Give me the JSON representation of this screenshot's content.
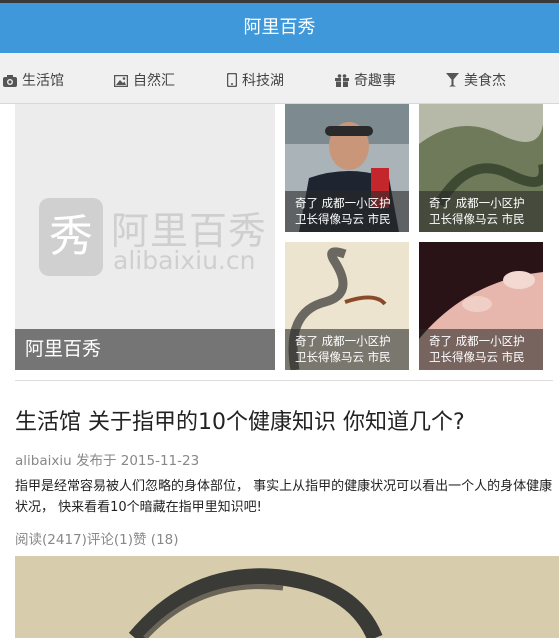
{
  "header": {
    "title": "阿里百秀"
  },
  "nav": {
    "items": [
      {
        "label": "生活馆",
        "icon": "camera-icon"
      },
      {
        "label": "自然汇",
        "icon": "picture-icon"
      },
      {
        "label": "科技湖",
        "icon": "phone-icon"
      },
      {
        "label": "奇趣事",
        "icon": "gift-icon"
      },
      {
        "label": "美食杰",
        "icon": "cocktail-icon"
      }
    ]
  },
  "hero": {
    "logo_char": "秀",
    "logo_title": "阿里百秀",
    "logo_sub": "alibaixiu.cn",
    "caption": "阿里百秀"
  },
  "thumbs": [
    {
      "line1": "奇了 成都一小区护",
      "line2": "卫长得像马云 市民"
    },
    {
      "line1": "奇了 成都一小区护",
      "line2": "卫长得像马云 市民"
    },
    {
      "line1": "奇了 成都一小区护",
      "line2": "卫长得像马云 市民"
    },
    {
      "line1": "奇了 成都一小区护",
      "line2": "卫长得像马云 市民"
    }
  ],
  "article": {
    "title": "生活馆 关于指甲的10个健康知识 你知道几个?",
    "meta": "alibaixiu 发布于 2015-11-23",
    "summary": "指甲是经常容易被人们忽略的身体部位， 事实上从指甲的健康状况可以看出一个人的身体健康状况， 快来看看10个暗藏在指甲里知识吧!",
    "stats": "阅读(2417)评论(1)赞 (18)"
  },
  "colors": {
    "header_bg": "#3f98d9",
    "nav_bg": "#f0f0f0"
  }
}
